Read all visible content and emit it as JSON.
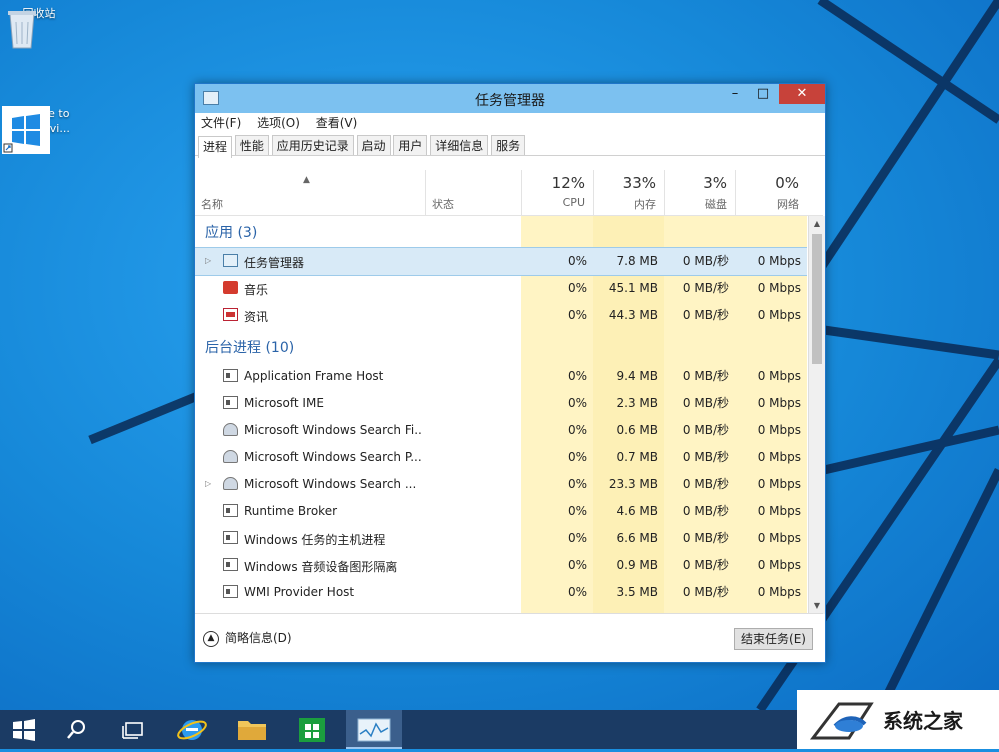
{
  "desktop": {
    "icons": [
      {
        "label": "回收站"
      },
      {
        "label": "Welcome to Tech Previ..."
      }
    ]
  },
  "window": {
    "title": "任务管理器",
    "controls": {
      "minimize": "–",
      "maximize": "□",
      "close": "✕"
    },
    "menu": [
      "文件(F)",
      "选项(O)",
      "查看(V)"
    ],
    "tabs": [
      "进程",
      "性能",
      "应用历史记录",
      "启动",
      "用户",
      "详细信息",
      "服务"
    ],
    "active_tab": "进程",
    "columns": {
      "name": "名称",
      "status": "状态",
      "cpu": {
        "pct": "12%",
        "label": "CPU"
      },
      "memory": {
        "pct": "33%",
        "label": "内存"
      },
      "disk": {
        "pct": "3%",
        "label": "磁盘"
      },
      "network": {
        "pct": "0%",
        "label": "网络"
      }
    },
    "groups": [
      {
        "title": "应用 (3)",
        "rows": [
          {
            "name": "任务管理器",
            "icon": "task-manager-icon",
            "expandable": true,
            "selected": true,
            "cpu": "0%",
            "mem": "7.8 MB",
            "disk": "0 MB/秒",
            "net": "0 Mbps"
          },
          {
            "name": "音乐",
            "icon": "music-icon",
            "expandable": false,
            "cpu": "0%",
            "mem": "45.1 MB",
            "disk": "0 MB/秒",
            "net": "0 Mbps"
          },
          {
            "name": "资讯",
            "icon": "news-icon",
            "expandable": false,
            "cpu": "0%",
            "mem": "44.3 MB",
            "disk": "0 MB/秒",
            "net": "0 Mbps"
          }
        ]
      },
      {
        "title": "后台进程 (10)",
        "rows": [
          {
            "name": "Application Frame Host",
            "icon": "app-window-icon",
            "expandable": false,
            "cpu": "0%",
            "mem": "9.4 MB",
            "disk": "0 MB/秒",
            "net": "0 Mbps"
          },
          {
            "name": "Microsoft IME",
            "icon": "app-window-icon",
            "expandable": false,
            "cpu": "0%",
            "mem": "2.3 MB",
            "disk": "0 MB/秒",
            "net": "0 Mbps"
          },
          {
            "name": "Microsoft Windows Search Fi...",
            "icon": "search-user-icon",
            "expandable": false,
            "cpu": "0%",
            "mem": "0.6 MB",
            "disk": "0 MB/秒",
            "net": "0 Mbps"
          },
          {
            "name": "Microsoft Windows Search P...",
            "icon": "search-user-icon",
            "expandable": false,
            "cpu": "0%",
            "mem": "0.7 MB",
            "disk": "0 MB/秒",
            "net": "0 Mbps"
          },
          {
            "name": "Microsoft Windows Search ...",
            "icon": "search-user-icon",
            "expandable": true,
            "cpu": "0%",
            "mem": "23.3 MB",
            "disk": "0 MB/秒",
            "net": "0 Mbps"
          },
          {
            "name": "Runtime Broker",
            "icon": "app-window-icon",
            "expandable": false,
            "cpu": "0%",
            "mem": "4.6 MB",
            "disk": "0 MB/秒",
            "net": "0 Mbps"
          },
          {
            "name": "Windows 任务的主机进程",
            "icon": "app-window-icon",
            "expandable": false,
            "cpu": "0%",
            "mem": "6.6 MB",
            "disk": "0 MB/秒",
            "net": "0 Mbps"
          },
          {
            "name": "Windows 音频设备图形隔离",
            "icon": "app-window-icon",
            "expandable": false,
            "cpu": "0%",
            "mem": "0.9 MB",
            "disk": "0 MB/秒",
            "net": "0 Mbps"
          },
          {
            "name": "WMI Provider Host",
            "icon": "app-window-icon",
            "expandable": false,
            "cpu": "0%",
            "mem": "3.5 MB",
            "disk": "0 MB/秒",
            "net": "0 Mbps"
          }
        ]
      }
    ],
    "footer": {
      "fewer_details": "简略信息(D)",
      "end_task": "结束任务(E)"
    }
  },
  "taskbar": {
    "items": [
      "start-icon",
      "search-icon",
      "task-view-icon",
      "ie-icon",
      "file-explorer-icon",
      "store-icon",
      "task-manager-icon"
    ]
  },
  "watermark": {
    "text": "系统之家"
  }
}
